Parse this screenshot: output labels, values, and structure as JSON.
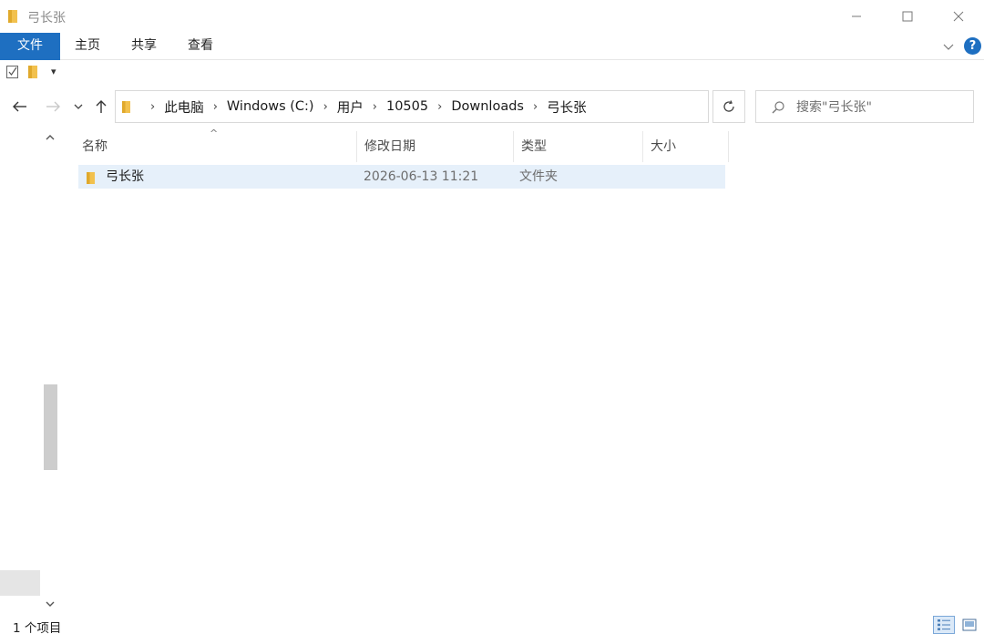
{
  "window": {
    "title": "弓长张"
  },
  "ribbon": {
    "tabs": [
      {
        "label": "文件",
        "active": true
      },
      {
        "label": "主页"
      },
      {
        "label": "共享"
      },
      {
        "label": "查看"
      }
    ],
    "help_label": "?"
  },
  "quick_access": {
    "customize_label": "▾"
  },
  "address": {
    "breadcrumbs": [
      "此电脑",
      "Windows (C:)",
      "用户",
      "10505",
      "Downloads",
      "弓长张"
    ]
  },
  "search": {
    "placeholder": "搜索\"弓长张\""
  },
  "filelist": {
    "columns": [
      "名称",
      "修改日期",
      "类型",
      "大小"
    ],
    "rows": [
      {
        "name": "弓长张",
        "date": "2026-06-13 11:21",
        "type": "文件夹",
        "size": ""
      }
    ]
  },
  "status": {
    "text": "1 个项目"
  },
  "colors": {
    "accent": "#1e6fc1",
    "selection": "#e6f0fa",
    "folder": "#f2c14e"
  }
}
